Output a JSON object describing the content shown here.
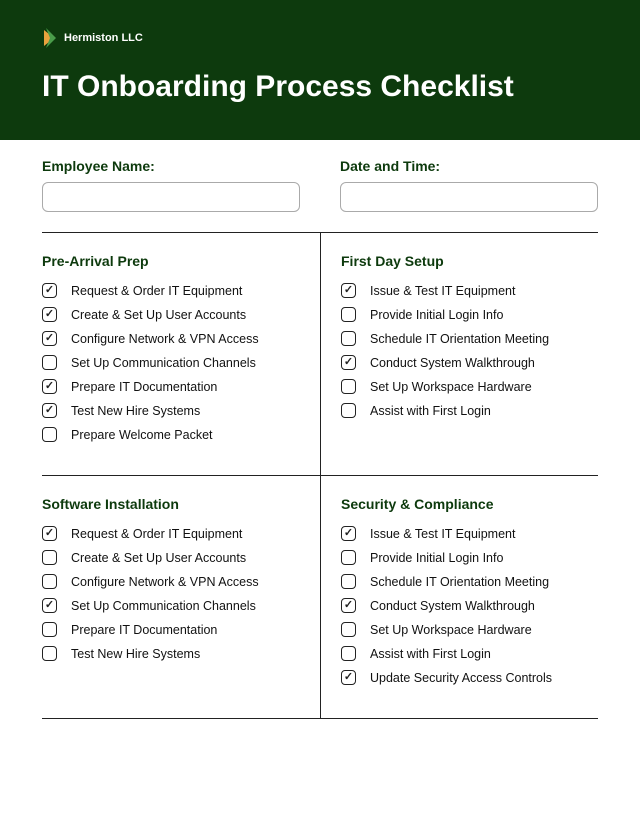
{
  "company": "Hermiston LLC",
  "title": "IT Onboarding Process Checklist",
  "fields": {
    "employee_name": {
      "label": "Employee Name:",
      "value": ""
    },
    "date_time": {
      "label": "Date and Time:",
      "value": ""
    }
  },
  "sections": [
    {
      "title": "Pre-Arrival Prep",
      "items": [
        {
          "label": "Request & Order IT Equipment",
          "checked": true
        },
        {
          "label": "Create & Set Up User Accounts",
          "checked": true
        },
        {
          "label": "Configure Network & VPN Access",
          "checked": true
        },
        {
          "label": "Set Up Communication Channels",
          "checked": false
        },
        {
          "label": "Prepare IT Documentation",
          "checked": true
        },
        {
          "label": "Test New Hire Systems",
          "checked": true
        },
        {
          "label": "Prepare Welcome Packet",
          "checked": false
        }
      ]
    },
    {
      "title": "First Day Setup",
      "items": [
        {
          "label": "Issue & Test IT Equipment",
          "checked": true
        },
        {
          "label": "Provide Initial Login Info",
          "checked": false
        },
        {
          "label": "Schedule IT Orientation Meeting",
          "checked": false
        },
        {
          "label": "Conduct System Walkthrough",
          "checked": true
        },
        {
          "label": "Set Up Workspace Hardware",
          "checked": false
        },
        {
          "label": "Assist with First Login",
          "checked": false
        }
      ]
    },
    {
      "title": "Software Installation",
      "items": [
        {
          "label": "Request & Order IT Equipment",
          "checked": true
        },
        {
          "label": "Create & Set Up User Accounts",
          "checked": false
        },
        {
          "label": "Configure Network & VPN Access",
          "checked": false
        },
        {
          "label": "Set Up Communication Channels",
          "checked": true
        },
        {
          "label": "Prepare IT Documentation",
          "checked": false
        },
        {
          "label": "Test New Hire Systems",
          "checked": false
        }
      ]
    },
    {
      "title": "Security & Compliance",
      "items": [
        {
          "label": "Issue & Test IT Equipment",
          "checked": true
        },
        {
          "label": "Provide Initial Login Info",
          "checked": false
        },
        {
          "label": "Schedule IT Orientation Meeting",
          "checked": false
        },
        {
          "label": "Conduct System Walkthrough",
          "checked": true
        },
        {
          "label": "Set Up Workspace Hardware",
          "checked": false
        },
        {
          "label": "Assist with First Login",
          "checked": false
        },
        {
          "label": "Update Security Access Controls",
          "checked": true
        }
      ]
    }
  ]
}
